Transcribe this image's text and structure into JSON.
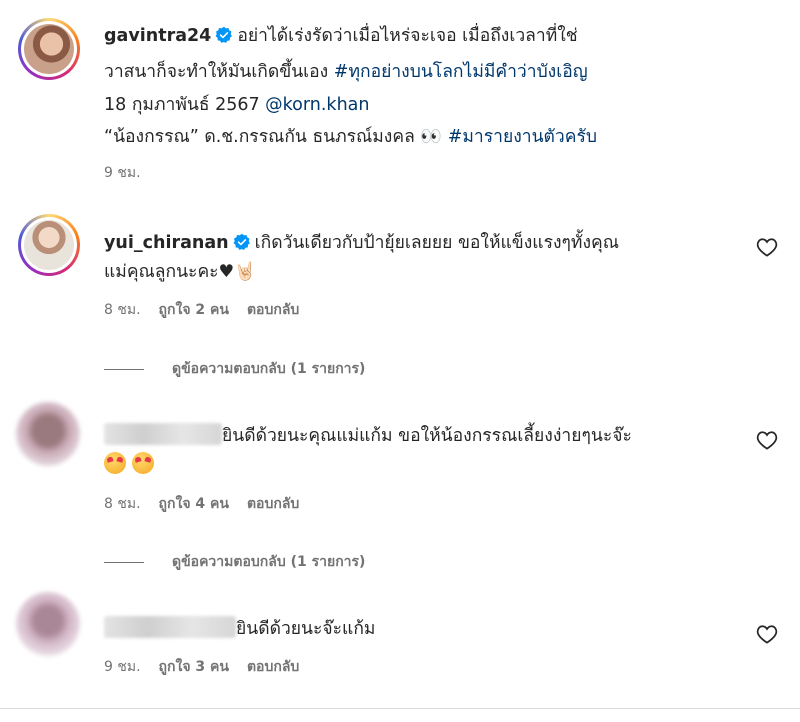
{
  "post": {
    "username": "gavintra24",
    "line1": "อย่าได้เร่งรัดว่าเมื่อไหร่จะเจอ เมื่อถึงเวลาที่ใช่",
    "line2_text": "วาสนาก็จะทำให้มันเกิดขึ้นเอง ",
    "line2_tag": "#ทุกอย่างบนโลกไม่มีคำว่าบังเอิญ",
    "line3_text": "18 กุมภาพันธ์ 2567 ",
    "line3_mention": "@korn.khan",
    "line4_text": "“น้องกรรณ” ด.ช.กรรณกัน ธนภรณ์มงคล 👀 ",
    "line4_tag": "#มารายงานตัวครับ",
    "time": "9 ชม."
  },
  "comments": [
    {
      "username": "yui_chiranan",
      "line1": "เกิดวันเดียวกับป้ายุ้ยเลยยย ขอให้แข็งแรงๆทั้งคุณ",
      "line2": "แม่คุณลูกนะคะ♥🤘🏻",
      "time": "8 ชม.",
      "likes": "ถูกใจ 2 คน",
      "reply": "ตอบกลับ",
      "view_replies": "ดูข้อความตอบกลับ (1 รายการ)"
    },
    {
      "line1": "ยินดีด้วยนะคุณแม่แก้ม ขอให้น้องกรรณเลี้ยงง่ายๆนะจ๊ะ",
      "time": "8 ชม.",
      "likes": "ถูกใจ 4 คน",
      "reply": "ตอบกลับ",
      "view_replies": "ดูข้อความตอบกลับ (1 รายการ)"
    },
    {
      "line1": "ยินดีด้วยนะจ๊ะแก้ม",
      "time": "9 ชม.",
      "likes": "ถูกใจ 3 คน",
      "reply": "ตอบกลับ"
    }
  ],
  "icons": {
    "verified": "verified-badge-icon",
    "like": "heart-outline-icon"
  },
  "colors": {
    "verified": "#0095f6",
    "link": "#00376b",
    "meta": "#737373"
  }
}
